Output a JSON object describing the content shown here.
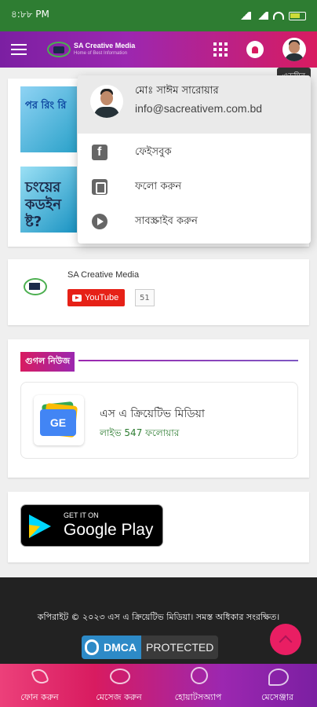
{
  "status_bar": {
    "time": "৪:৮৮ PM"
  },
  "header": {
    "logo_title": "SA Creative Media",
    "logo_subtitle": "Home of Best Information",
    "admin_tooltip": "এডমিন"
  },
  "posts": {
    "thumb1_text": "পর রিং রি",
    "thumb2_text": "চংয়ের কডইন ষ্ট?"
  },
  "youtube_widget": {
    "channel_name": "SA Creative Media",
    "button_label": "YouTube",
    "subscriber_count": "51"
  },
  "google_news": {
    "section_title": "গুগল নিউজ",
    "icon_label": "GE",
    "name": "এস এ ক্রিয়েটিভ মিডিয়া",
    "followers": "লাইভ 547 ফলোয়ার"
  },
  "google_play": {
    "small": "GET IT ON",
    "big": "Google Play"
  },
  "footer": {
    "copyright": "কপিরাইট © ২০২৩ এস এ ক্রিয়েটিভ মিডিয়া। সমস্ত অধিকার সংরক্ষিত।",
    "dmca_left": "DMCA",
    "dmca_right": "PROTECTED"
  },
  "bottom_nav": {
    "call": "ফোন করুন",
    "message": "মেসেজ করুন",
    "whatsapp": "হোয়াটসঅ্যাপ",
    "messenger": "মেসেঞ্জার"
  },
  "dropdown": {
    "name": "মোঃ সাঈম সারোয়ার",
    "email": "info@sacreativem.com.bd",
    "items": [
      {
        "label": "ফেইসবুক",
        "icon": "facebook-icon"
      },
      {
        "label": "ফলো করুন",
        "icon": "blogger-icon"
      },
      {
        "label": "সাবস্ক্রাইব করুন",
        "icon": "play-icon"
      }
    ]
  },
  "colors": {
    "status_bar": "#2e7d32",
    "header_start": "#7b1fa2",
    "header_end": "#d81b60",
    "accent": "#e91e63",
    "footer": "#222222"
  }
}
